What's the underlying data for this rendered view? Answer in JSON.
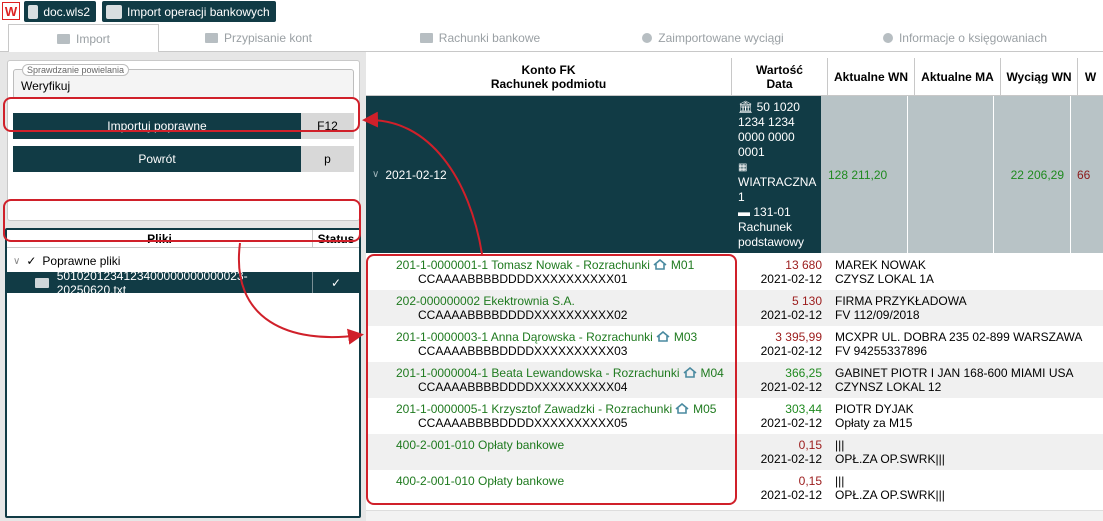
{
  "topbar": {
    "logo": "W",
    "tab1": "doc.wls2",
    "tab2": "Import operacji bankowych"
  },
  "nav": {
    "tabs": [
      "Import",
      "Przypisanie kont",
      "Rachunki bankowe",
      "Zaimportowane wyciągi",
      "Informacje o księgowaniach"
    ]
  },
  "left": {
    "legend": "Sprawdzanie powielania",
    "check_value": "Weryfikuj",
    "import_btn": "Importuj poprawne",
    "import_key": "F12",
    "back_btn": "Powrót",
    "back_key": "p",
    "files_col": "Pliki",
    "status_col": "Status",
    "group": "Poprawne pliki",
    "file": "5010201234123400000000000023-20250620.txt",
    "file_status": "✓"
  },
  "table": {
    "h1a": "Konto FK",
    "h1b": "Rachunek podmiotu",
    "h2a": "Wartość",
    "h2b": "Data",
    "h3": "Aktualne WN",
    "h4": "Aktualne MA",
    "h5": "Wyciąg WN",
    "h6": "W",
    "group": {
      "date": "2021-02-12",
      "acct1": "50 1020",
      "acct2": "1234 1234",
      "acct3": "0000 0000",
      "acct4": "0001",
      "acct5": "WIATRACZNA",
      "acct6": "1",
      "acct7": "131-01",
      "acct8": "Rachunek",
      "acct9": "podstawowy",
      "wn": "128 211,20",
      "wyciag": "22 206,29",
      "w": "66"
    },
    "rows": [
      {
        "t": "201-1-0000001-1 Tomasz Nowak - Rozrachunki",
        "m": "M01",
        "s": "CCAAAABBBBDDDDXXXXXXXXXX01",
        "v": "13 680",
        "vc": "red",
        "d": "2021-02-12",
        "l1": "MAREK NOWAK",
        "l2": "CZYSZ LOKAL 1A"
      },
      {
        "t": "202-000000002 Ekektrownia S.A.",
        "m": "",
        "s": "CCAAAABBBBDDDDXXXXXXXXXX02",
        "v": "5 130",
        "vc": "red",
        "d": "2021-02-12",
        "l1": "FIRMA PRZYKŁADOWA",
        "l2": "FV 112/09/2018"
      },
      {
        "t": "201-1-0000003-1 Anna Dąrowska - Rozrachunki",
        "m": "M03",
        "s": "CCAAAABBBBDDDDXXXXXXXXXX03",
        "v": "3 395,99",
        "vc": "red",
        "d": "2021-02-12",
        "l1": "MCXPR UL. DOBRA 235 02-899 WARSZAWA",
        "l2": "FV 94255337896"
      },
      {
        "t": "201-1-0000004-1 Beata Lewandowska - Rozrachunki",
        "m": "M04",
        "s": "CCAAAABBBBDDDDXXXXXXXXXX04",
        "v": "366,25",
        "vc": "grn",
        "d": "2021-02-12",
        "l1": "GABINET PIOTR I JAN 168-600 MIAMI USA",
        "l2": "CZYNSZ LOKAL 12"
      },
      {
        "t": "201-1-0000005-1 Krzysztof Zawadzki - Rozrachunki",
        "m": "M05",
        "s": "CCAAAABBBBDDDDXXXXXXXXXX05",
        "v": "303,44",
        "vc": "grn",
        "d": "2021-02-12",
        "l1": "PIOTR DYJAK",
        "l2": "Opłaty za M15"
      },
      {
        "t": "400-2-001-010 Opłaty bankowe",
        "m": "",
        "s": "",
        "v": "0,15",
        "vc": "red",
        "d": "2021-02-12",
        "l1": "|||",
        "l2": "OPŁ.ZA OP.SWRK|||"
      },
      {
        "t": "400-2-001-010 Opłaty bankowe",
        "m": "",
        "s": "",
        "v": "0,15",
        "vc": "red",
        "d": "2021-02-12",
        "l1": "|||",
        "l2": "OPŁ.ZA OP.SWRK|||"
      }
    ]
  }
}
